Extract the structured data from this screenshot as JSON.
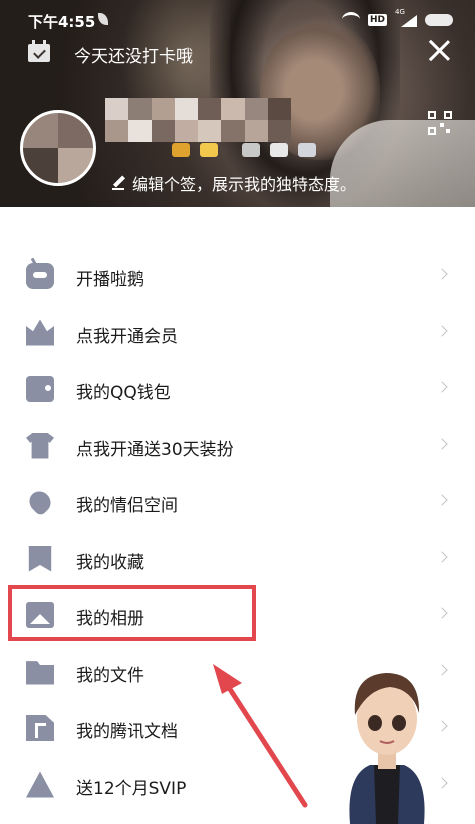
{
  "status_bar": {
    "time": "下午4:55",
    "hd": "HD",
    "network": "4G"
  },
  "checkin": {
    "text": "今天还没打卡哦"
  },
  "profile": {
    "signature": "编辑个签，展示我的独特态度。"
  },
  "menu": {
    "items": [
      {
        "label": "开播啦鹅",
        "icon": "tv-icon"
      },
      {
        "label": "点我开通会员",
        "icon": "crown-icon"
      },
      {
        "label": "我的QQ钱包",
        "icon": "wallet-icon"
      },
      {
        "label": "点我开通送30天装扮",
        "icon": "shirt-icon"
      },
      {
        "label": "我的情侣空间",
        "icon": "heart-icon"
      },
      {
        "label": "我的收藏",
        "icon": "bookmark-icon"
      },
      {
        "label": "我的相册",
        "icon": "photo-icon"
      },
      {
        "label": "我的文件",
        "icon": "folder-icon"
      },
      {
        "label": "我的腾讯文档",
        "icon": "document-icon"
      },
      {
        "label": "送12个月SVIP",
        "icon": "broadcast-icon"
      }
    ]
  },
  "colors": {
    "accent_highlight": "#e2474d",
    "icon_gray": "#8a8fa3"
  }
}
